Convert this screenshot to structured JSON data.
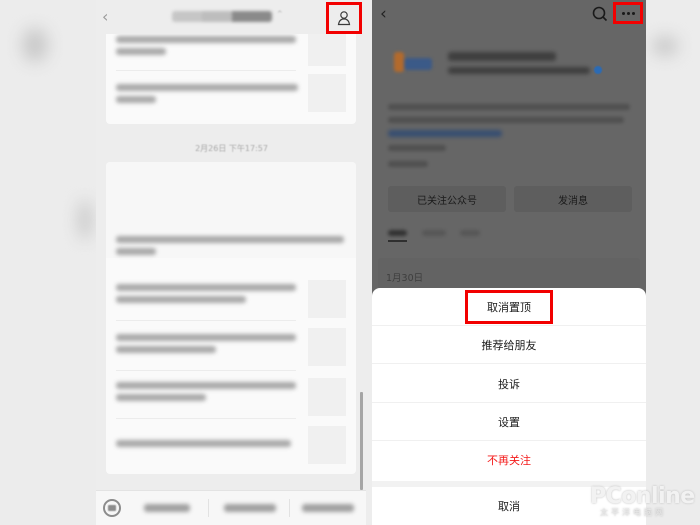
{
  "left_screen": {
    "header": {
      "back_icon": "chevron-left-icon",
      "title": "广东电信天翼高清",
      "profile_icon": "person-icon"
    },
    "chat": {
      "timestamp": "2月26日 下午17:57",
      "cards": [
        {
          "articles": [
            {
              "title": "【超值专享】只需狂欢购电影大片，超精彩"
            },
            {
              "title": "【6月份热点】高价：有不好进行视频吗了…"
            }
          ]
        },
        {
          "cover_caption": "【热门推荐】《追寻新的踪》以你的广上领先精彩内容",
          "articles": [
            {
              "title": "【热门推荐】《追你》在求也再将领：请略等，会员分开发上排播片内容"
            },
            {
              "title": "【热门推荐】再做时在看后，《尊贵体》号前场发布观者团页的时间"
            },
            {
              "title": "【热门推荐】《什小我上升以》指价不能，精彩页目前推荐"
            },
            {
              "title": "【新年福利】岁个冒险，说我天翼高清"
            }
          ]
        }
      ]
    },
    "bottom_menu": {
      "keyboard_icon": "keyboard-toggle-icon",
      "items": [
        "精彩每周",
        "精彩推荐",
        "我的服务"
      ]
    }
  },
  "right_screen": {
    "header": {
      "back_icon": "chevron-left-icon",
      "search_icon": "search-icon",
      "more_icon": "more-dots-icon"
    },
    "profile": {
      "name": "广东电信天翼高清",
      "company": "中国电信股份有限公司广东分公司",
      "verified_icon": "verified-badge-icon",
      "description": "广东IPTV官方服务号，在线查询观看节目内容，点播优质节目，精彩活动尽在天翼高清。",
      "link_text": "服务号：广东电信天翼高清",
      "meta_lines": [
        "已推送过的内容",
        "IP地址：广东"
      ]
    },
    "buttons": {
      "followed": "已关注公众号",
      "send_message": "发消息"
    },
    "tabs": [
      "消息",
      "视频号",
      "服务"
    ],
    "date_label": "1月30日",
    "action_sheet": {
      "items": [
        {
          "label": "取消置顶",
          "highlighted": true,
          "style": "normal"
        },
        {
          "label": "推荐给朋友",
          "style": "normal"
        },
        {
          "label": "投诉",
          "style": "normal"
        },
        {
          "label": "设置",
          "style": "normal"
        },
        {
          "label": "不再关注",
          "style": "danger"
        }
      ],
      "cancel": "取消"
    }
  },
  "watermark": {
    "brand": "PConline",
    "sub": "太平洋电脑网"
  },
  "colors": {
    "highlight_box": "#f20000",
    "danger_text": "#f41b1b",
    "overlay": "#666666"
  }
}
